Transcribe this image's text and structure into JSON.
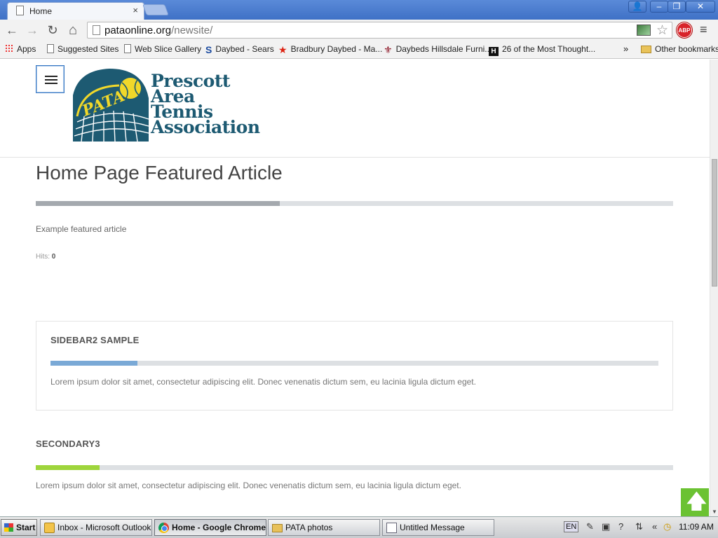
{
  "browser": {
    "tab_title": "Home",
    "tab_close": "×",
    "url_host": "pataonline.org",
    "url_path": "/newsite/",
    "abp_label": "ABP",
    "window_controls": {
      "user": "👤",
      "minimize": "–",
      "restore": "❐",
      "close": "✕"
    },
    "nav": {
      "back": "←",
      "forward": "→",
      "reload": "↻",
      "home": "⌂",
      "star": "☆",
      "menu": "≡"
    }
  },
  "bookmarks": {
    "items": [
      {
        "label": "Apps",
        "icon": "apps-grid-icon"
      },
      {
        "label": "Suggested Sites",
        "icon": "page-icon"
      },
      {
        "label": "Web Slice Gallery",
        "icon": "page-icon"
      },
      {
        "label": "Daybed - Sears",
        "icon": "sears-icon"
      },
      {
        "label": "Bradbury Daybed - Ma...",
        "icon": "macys-star-icon"
      },
      {
        "label": "Daybeds Hillsdale Furni...",
        "icon": "fleur-icon"
      },
      {
        "label": "26 of the Most Thought...",
        "icon": "houzz-icon"
      }
    ],
    "overflow": "»",
    "other": "Other bookmarks"
  },
  "page": {
    "logo_text": [
      "Prescott",
      "Area",
      "Tennis",
      "Association"
    ],
    "logo_badge": "PATA",
    "article_title": "Home Page Featured Article",
    "article_body": "Example featured article",
    "hits_label": "Hits:",
    "hits_value": "0",
    "sidebar2": {
      "title": "SIDEBAR2 SAMPLE",
      "text": "Lorem ipsum dolor sit amet, consectetur adipiscing elit. Donec venenatis dictum sem, eu lacinia ligula dictum eget."
    },
    "secondary3": {
      "title": "SECONDARY3",
      "text": "Lorem ipsum dolor sit amet, consectetur adipiscing elit. Donec venenatis dictum sem, eu lacinia ligula dictum eget."
    }
  },
  "colors": {
    "title_accent": "#a4a9ae",
    "sidebar_accent": "#7aa9d6",
    "secondary_accent": "#9ed53c",
    "logo_blue": "#1d5a72",
    "logo_yellow": "#f1d82a",
    "back_to_top": "#6bc232"
  },
  "taskbar": {
    "start": "Start",
    "tasks": [
      {
        "label": "Inbox - Microsoft Outlook"
      },
      {
        "label": "Home - Google Chrome"
      },
      {
        "label": "PATA photos"
      },
      {
        "label": "Untitled Message"
      }
    ],
    "lang": "EN",
    "tray_chevron": "«",
    "clock": "11:09 AM"
  }
}
